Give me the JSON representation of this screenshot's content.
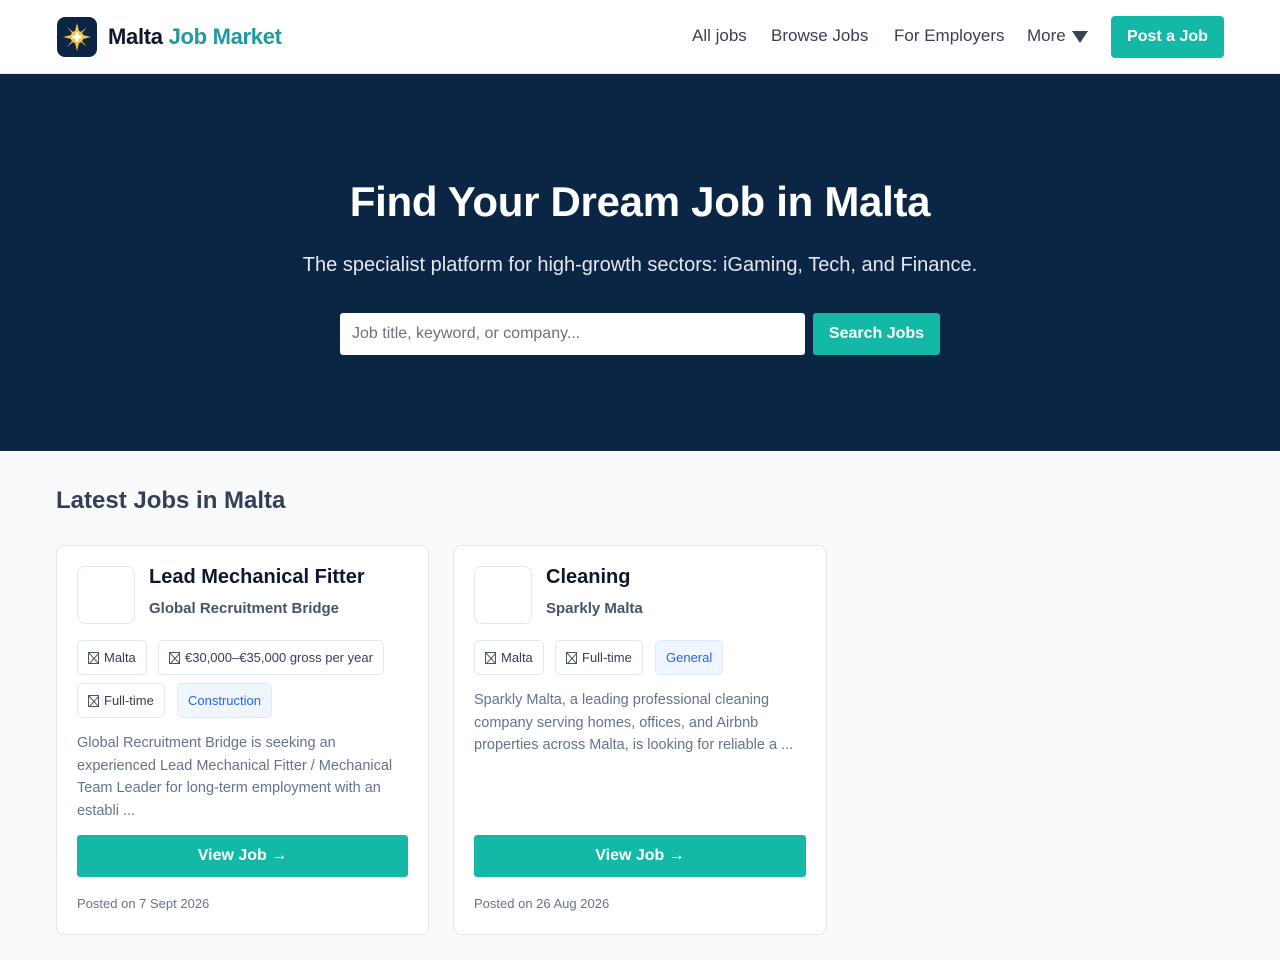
{
  "brand": {
    "name_part1": "Malta",
    "name_part2": "Job Market"
  },
  "nav": {
    "links": [
      "All jobs",
      "Browse Jobs",
      "For Employers"
    ],
    "more_label": "More",
    "post_label": "Post a Job"
  },
  "hero": {
    "title": "Find Your Dream Job in Malta",
    "subtitle": "The specialist platform for high-growth sectors: iGaming, Tech, and Finance.",
    "search_placeholder": "Job title, keyword, or company...",
    "search_label": "Search Jobs"
  },
  "latest": {
    "title": "Latest Jobs in Malta",
    "jobs": [
      {
        "title": "Lead Mechanical Fitter",
        "company": "Global Recruitment Bridge",
        "location": "Malta",
        "salary": "€30,000–€35,000 gross per year",
        "type": "Full-time",
        "category": "Construction",
        "description": "Global Recruitment Bridge is seeking an experienced Lead Mechanical Fitter / Mechanical Team Leader for long-term employment with an establi ...",
        "view_label": "View Job →",
        "posted": "Posted on 7 Sept 2026"
      },
      {
        "title": "Cleaning",
        "company": "Sparkly Malta",
        "location": "Malta",
        "type": "Full-time",
        "category": "General",
        "description": "Sparkly Malta, a leading professional cleaning company serving homes, offices, and Airbnb properties across Malta, is looking for reliable a ...",
        "view_label": "View Job →",
        "posted": "Posted on 26 Aug 2026"
      }
    ]
  },
  "colors": {
    "navy": "#0b2545",
    "teal": "#14b8a6",
    "brand_teal": "#1f9ba0",
    "logo_sun": "#f5c242"
  },
  "icons": {
    "logo": "malta-cross-sun-icon",
    "more": "caret-down-icon",
    "tag": "missing-glyph-icon"
  }
}
